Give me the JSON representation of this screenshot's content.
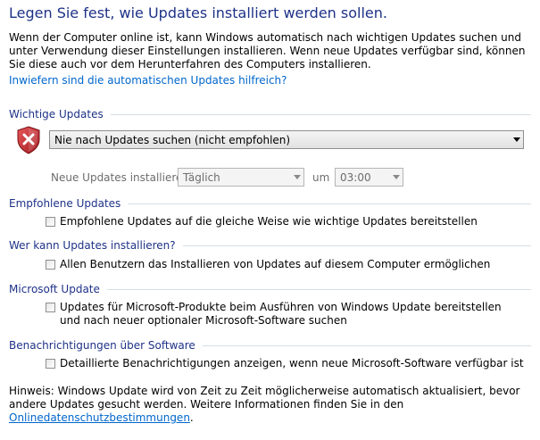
{
  "page": {
    "title": "Legen Sie fest, wie Updates installiert werden sollen.",
    "intro": "Wenn der Computer online ist, kann Windows automatisch nach wichtigen Updates suchen und unter Verwendung dieser Einstellungen installieren. Wenn neue Updates verfügbar sind, können Sie diese auch vor dem Herunterfahren des Computers installieren.",
    "help_link": "Inwiefern sind die automatischen Updates hilfreich?"
  },
  "important_updates": {
    "heading": "Wichtige Updates",
    "icon": "shield-error-icon",
    "selected_option": "Nie nach Updates suchen (nicht empfohlen)",
    "install_label": "Neue Updates installieren:",
    "day_value": "Täglich",
    "at_label": "um",
    "time_value": "03:00"
  },
  "recommended_updates": {
    "heading": "Empfohlene Updates",
    "checkbox_label": "Empfohlene Updates auf die gleiche Weise wie wichtige Updates bereitstellen",
    "checked": false
  },
  "who_can_install": {
    "heading": "Wer kann Updates installieren?",
    "checkbox_label": "Allen Benutzern das Installieren von Updates auf diesem Computer ermöglichen",
    "checked": false
  },
  "microsoft_update": {
    "heading": "Microsoft Update",
    "checkbox_label": "Updates für Microsoft-Produkte beim Ausführen von Windows Update bereitstellen und nach neuer optionaler Microsoft-Software suchen",
    "checked": false
  },
  "software_notifications": {
    "heading": "Benachrichtigungen über Software",
    "checkbox_label": "Detaillierte Benachrichtigungen anzeigen, wenn neue Microsoft-Software verfügbar ist",
    "checked": false
  },
  "footer": {
    "note_text": "Hinweis: Windows Update wird von Zeit zu Zeit möglicherweise automatisch aktualisiert, bevor andere Updates gesucht werden. Weitere Informationen finden Sie in den ",
    "privacy_link": "Onlinedatenschutzbestimmungen",
    "note_end": "."
  },
  "colors": {
    "heading": "#1e3287",
    "link": "#0066cc",
    "rule": "#d5dfe5",
    "shield_red": "#c0282d"
  }
}
